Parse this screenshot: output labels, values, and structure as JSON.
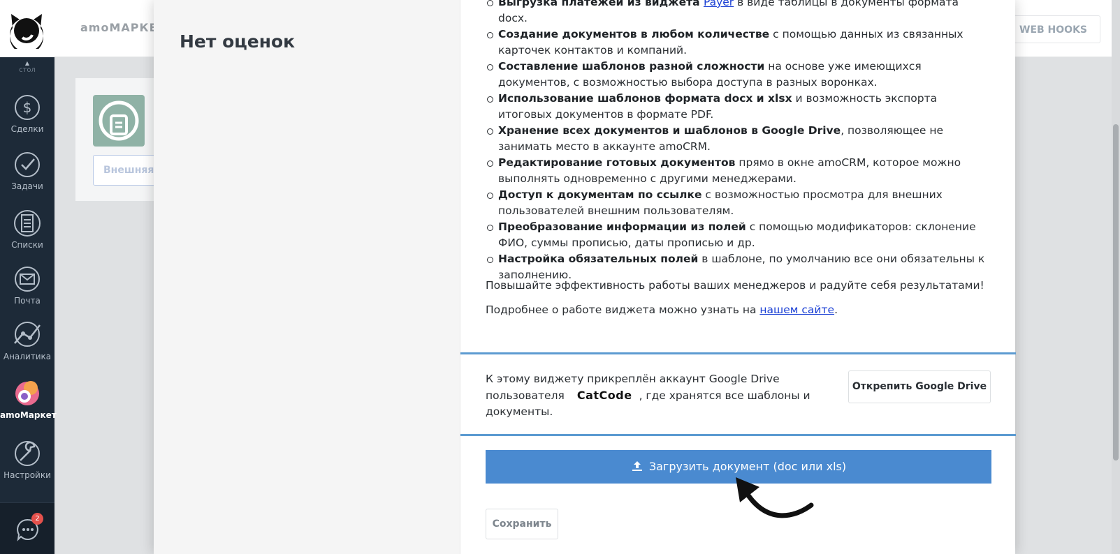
{
  "header": {
    "app_title": "amoМАРКЕ",
    "webhooks_label": "WEB HOOKS"
  },
  "nav": {
    "scroll_hint": "стол",
    "items": [
      {
        "label": "Сделки",
        "icon": "deals-dollar-icon"
      },
      {
        "label": "Задачи",
        "icon": "tasks-check-icon"
      },
      {
        "label": "Списки",
        "icon": "lists-icon"
      },
      {
        "label": "Почта",
        "icon": "mail-icon"
      },
      {
        "label": "Аналитика",
        "icon": "analytics-icon"
      },
      {
        "label": "amoМаркет",
        "icon": "amomarket-icon"
      },
      {
        "label": "Настройки",
        "icon": "settings-wrench-icon"
      }
    ],
    "chat_badge": "2"
  },
  "background_card": {
    "external_button": "Внешняя"
  },
  "modal": {
    "rating_text": "Нет оценок",
    "features": [
      {
        "bold": "Выгрузка платежей из виджета ",
        "link": "Payer",
        "rest": " в виде таблицы в документы формата docx."
      },
      {
        "bold": "Создание документов в любом количестве",
        "rest": " с помощью данных из связанных карточек контактов и компаний."
      },
      {
        "bold": "Составление шаблонов разной сложности",
        "rest": " на основе уже имеющихся документов, с возможностью выбора доступа в разных воронках."
      },
      {
        "bold": "Использование шаблонов формата docx и xlsx",
        "rest": " и возможность экспорта итоговых документов в формате PDF."
      },
      {
        "bold": "Хранение всех документов и шаблонов в Google Drive",
        "rest": ", позволяющее не занимать место в аккаунте amoCRM."
      },
      {
        "bold": "Редактирование готовых документов",
        "rest": " прямо в окне amoCRM, которое можно выполнять одновременно с другими менеджерами."
      },
      {
        "bold": "Доступ к документам по ссылке",
        "rest": " с возможностью просмотра для внешних пользователей внешним пользователям."
      },
      {
        "bold": "Преобразование информации из полей",
        "rest": " с помощью модификаторов: склонение ФИО, суммы прописью, даты прописью и др."
      },
      {
        "bold": "Настройка обязательных полей",
        "rest": " в шаблоне, по умолчанию все они обязательны к заполнению."
      }
    ],
    "motivation": "Повышайте эффективность работы ваших менеджеров и радуйте себя результатами!",
    "more_info_prefix": "Подробнее о работе виджета можно узнать на ",
    "more_info_link": "нашем сайте",
    "more_info_suffix": ".",
    "gdrive": {
      "text_before": "К этому виджету прикреплён аккаунт Google Drive пользователя",
      "user": "CatCode",
      "text_after": ", где хранятся все шаблоны и документы.",
      "detach_button": "Открепить Google Drive"
    },
    "upload_button": "Загрузить документ (doc или xls)",
    "save_button": "Сохранить"
  },
  "colors": {
    "nav_bg": "#1d2a38",
    "accent_blue": "#4a8ad0",
    "divider_blue": "#5c9bd1",
    "link_blue": "#1a3fd4"
  }
}
